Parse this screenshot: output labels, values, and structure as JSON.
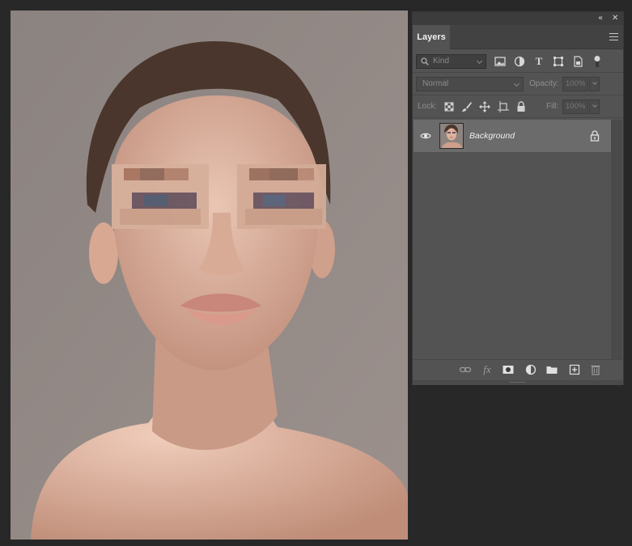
{
  "panel": {
    "collapse_icon": "double-chevron-left-icon",
    "close_icon": "close-icon",
    "tab_label": "Layers",
    "menu_icon": "hamburger-menu-icon"
  },
  "filter": {
    "kind_label": "Kind",
    "icons": [
      "image-filter-icon",
      "adjustment-filter-icon",
      "type-filter-icon",
      "shape-filter-icon",
      "smart-object-filter-icon",
      "filter-toggle-icon"
    ]
  },
  "blend": {
    "mode": "Normal",
    "opacity_label": "Opacity:",
    "opacity_value": "100%"
  },
  "locks": {
    "label": "Lock:",
    "icons": [
      "lock-transparent-icon",
      "lock-pixels-icon",
      "lock-position-icon",
      "lock-artboard-icon",
      "lock-all-icon"
    ],
    "fill_label": "Fill:",
    "fill_value": "100%"
  },
  "layers": [
    {
      "name": "Background",
      "visible": true,
      "locked": true
    }
  ],
  "bottom_icons": [
    "link-layers-icon",
    "fx-icon",
    "add-mask-icon",
    "adjustment-layer-icon",
    "new-group-icon",
    "new-layer-icon",
    "trash-icon"
  ],
  "colors": {
    "workspace": "#282828",
    "panel": "#535353",
    "selected_layer": "#6b6b6b",
    "canvas_bg": "#8d8480"
  }
}
